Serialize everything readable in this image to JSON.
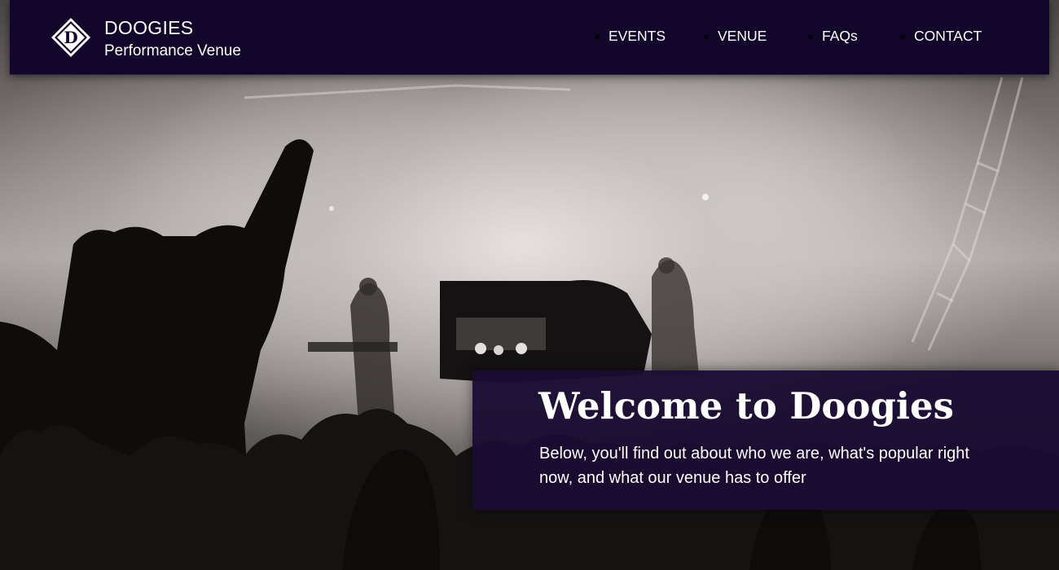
{
  "brand": {
    "name": "DOOGIES",
    "subtitle": "Performance Venue",
    "logo_letter": "D"
  },
  "nav": {
    "items": [
      {
        "label": "EVENTS"
      },
      {
        "label": "VENUE"
      },
      {
        "label": "FAQs"
      },
      {
        "label": "CONTACT"
      }
    ]
  },
  "hero": {
    "image_subject": "concert-crowd-photo"
  },
  "welcome": {
    "title": "Welcome to Doogies",
    "text": "Below, you'll find out about who we are, what's popular right now, and what our venue has to offer"
  },
  "colors": {
    "header_bg": "#12062a",
    "panel_bg": "#1a0c32",
    "text": "#ffffff"
  }
}
